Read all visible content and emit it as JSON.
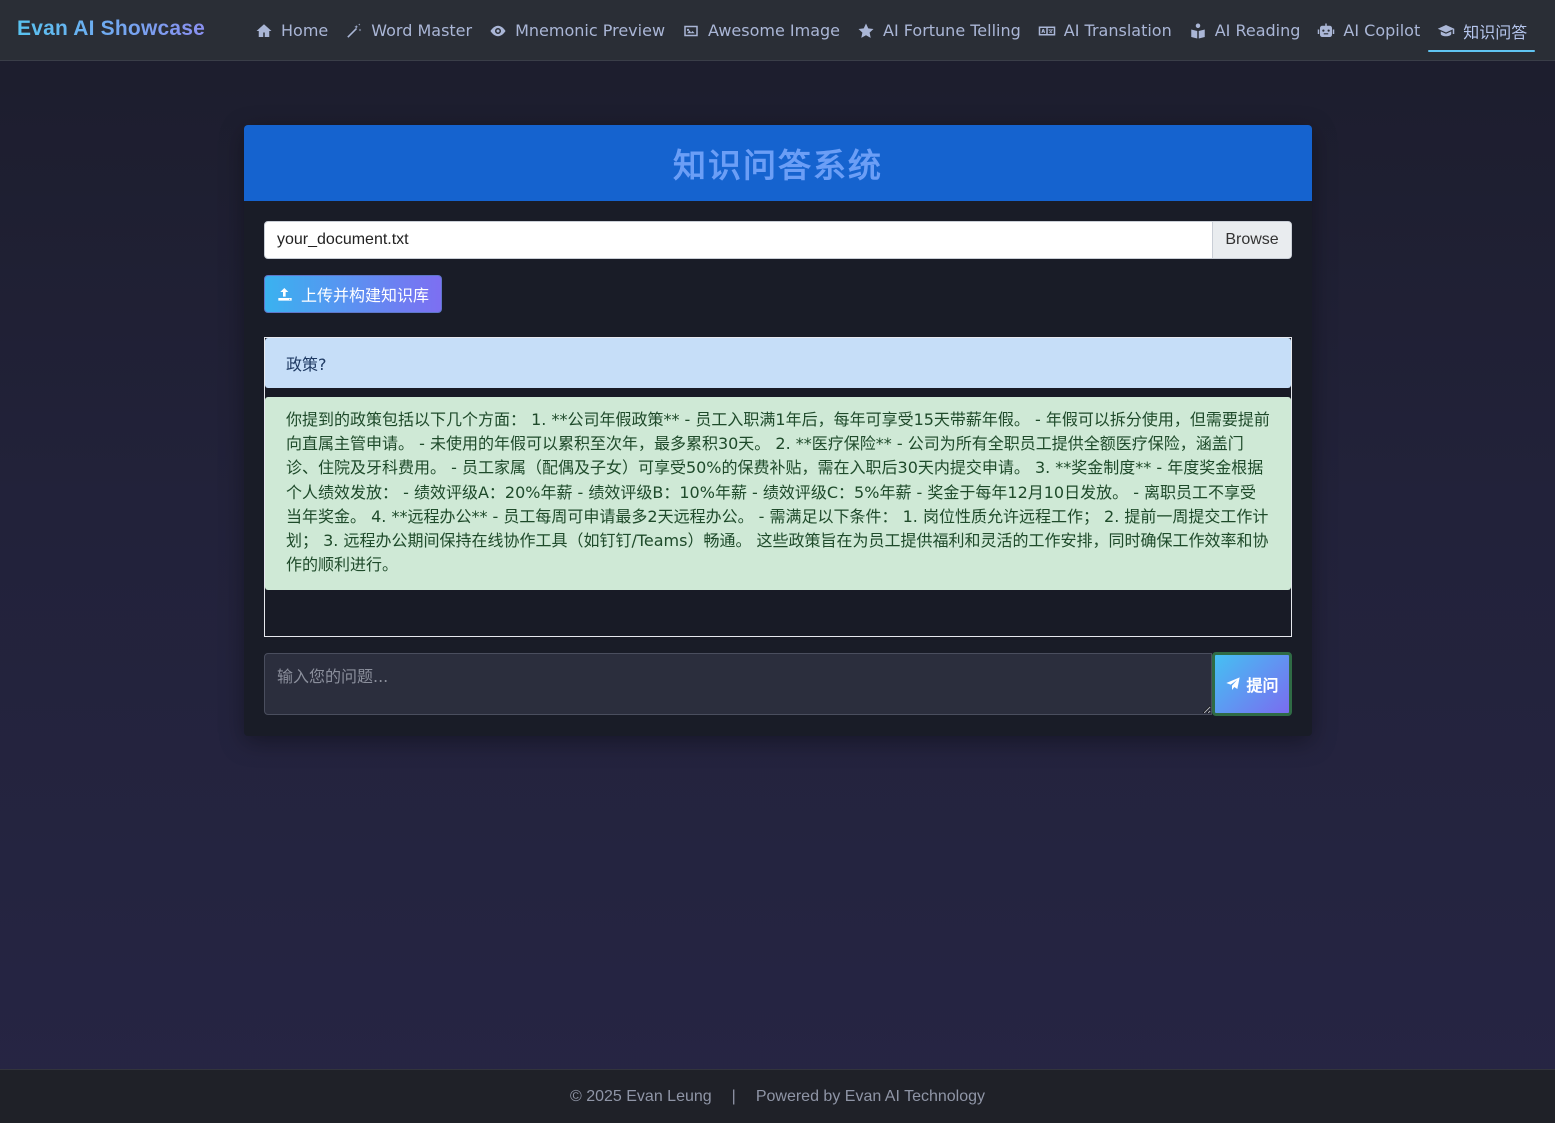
{
  "nav": {
    "brand": "Evan AI Showcase",
    "items": [
      {
        "label": "Home",
        "icon": "home-icon"
      },
      {
        "label": "Word Master",
        "icon": "magic-wand-icon"
      },
      {
        "label": "Mnemonic Preview",
        "icon": "eye-icon"
      },
      {
        "label": "Awesome Image",
        "icon": "image-icon"
      },
      {
        "label": "AI Fortune Telling",
        "icon": "star-icon"
      },
      {
        "label": "AI Translation",
        "icon": "language-icon"
      },
      {
        "label": "AI Reading",
        "icon": "book-reader-icon"
      },
      {
        "label": "AI Copilot",
        "icon": "robot-icon"
      },
      {
        "label": "知识问答",
        "icon": "graduation-cap-icon",
        "active": true
      }
    ]
  },
  "card": {
    "title": "知识问答系统",
    "file": {
      "value": "your_document.txt",
      "browse_label": "Browse"
    },
    "upload_label": "上传并构建知识库",
    "chat": {
      "user_message": "政策?",
      "bot_message": "你提到的政策包括以下几个方面： 1. **公司年假政策** - 员工入职满1年后，每年可享受15天带薪年假。 - 年假可以拆分使用，但需要提前向直属主管申请。 - 未使用的年假可以累积至次年，最多累积30天。 2. **医疗保险** - 公司为所有全职员工提供全额医疗保险，涵盖门诊、住院及牙科费用。 - 员工家属（配偶及子女）可享受50%的保费补贴，需在入职后30天内提交申请。 3. **奖金制度** - 年度奖金根据个人绩效发放： - 绩效评级A：20%年薪 - 绩效评级B：10%年薪 - 绩效评级C：5%年薪 - 奖金于每年12月10日发放。 - 离职员工不享受当年奖金。 4. **远程办公** - 员工每周可申请最多2天远程办公。 - 需满足以下条件： 1. 岗位性质允许远程工作； 2. 提前一周提交工作计划； 3. 远程办公期间保持在线协作工具（如钉钉/Teams）畅通。 这些政策旨在为员工提供福利和灵活的工作安排，同时确保工作效率和协作的顺利进行。"
    },
    "question": {
      "placeholder": "输入您的问题...",
      "value": ""
    },
    "ask_label": "提问"
  },
  "footer": {
    "copyright": "© 2025 Evan Leung",
    "separator": "|",
    "powered": "Powered by Evan AI Technology"
  },
  "colors": {
    "navbar_bg": "#2a2e36",
    "header_bg": "#1563cf",
    "user_bubble": "#c6def8",
    "bot_bubble": "#cfe9d6",
    "accent_start": "#3ab2f0",
    "accent_end": "#7d6ff2"
  }
}
